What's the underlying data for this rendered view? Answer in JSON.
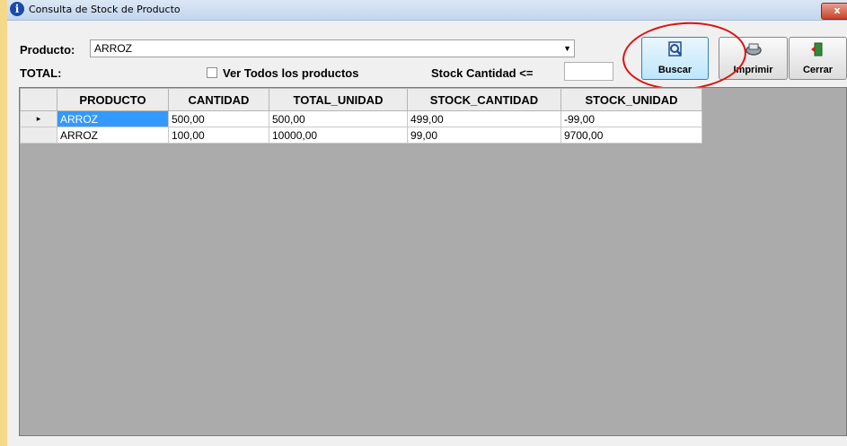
{
  "window": {
    "title": "Consulta de Stock de Producto",
    "info_icon": "i",
    "close_label": "x"
  },
  "form": {
    "producto_label": "Producto:",
    "producto_value": "ARROZ",
    "total_label": "TOTAL:",
    "ver_todos_label": "Ver Todos los productos",
    "ver_todos_checked": false,
    "stock_cantidad_label": "Stock Cantidad <=",
    "stock_cantidad_value": ""
  },
  "toolbar": {
    "buscar_label": "Buscar",
    "imprimir_label": "Imprimir",
    "cerrar_label": "Cerrar"
  },
  "grid": {
    "columns": [
      "PRODUCTO",
      "CANTIDAD",
      "TOTAL_UNIDAD",
      "STOCK_CANTIDAD",
      "STOCK_UNIDAD"
    ],
    "rows": [
      {
        "indicator": "▸",
        "cells": [
          "ARROZ",
          "500,00",
          "500,00",
          "499,00",
          "-99,00"
        ]
      },
      {
        "indicator": "",
        "cells": [
          "ARROZ",
          "100,00",
          "10000,00",
          "99,00",
          "9700,00"
        ]
      }
    ]
  },
  "colors": {
    "selection": "#3399ff",
    "highlight_circle": "#e01010",
    "grid_background": "#ababab"
  }
}
